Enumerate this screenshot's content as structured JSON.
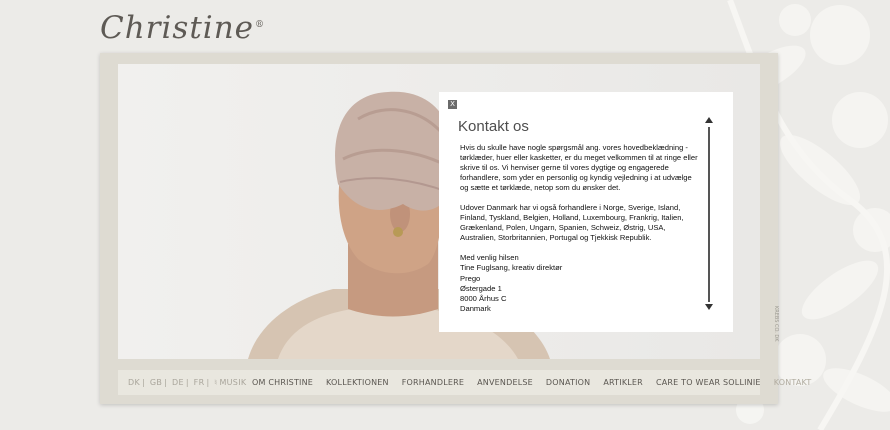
{
  "logo": {
    "text": "Christine",
    "mark": "®"
  },
  "panel": {
    "close_label": "X",
    "title": "Kontakt os",
    "paragraphs": [
      "Hvis du skulle have nogle spørgsmål ang. vores hovedbeklædning - tørklæder, huer eller kasketter, er du meget velkommen til at ringe eller skrive til os. Vi henviser gerne til vores dygtige og engagerede forhandlere, som yder en personlig og kyndig vejledning i at udvælge og sætte et tørklæde, netop som du ønsker det.",
      "Udover Danmark har vi også forhandlere i Norge, Sverige, Island, Finland, Tyskland, Belgien, Holland, Luxembourg, Frankrig, Italien, Grækenland, Polen, Ungarn, Spanien, Schweiz, Østrig, USA, Australien, Storbritannien, Portugal og Tjekkisk Republik."
    ],
    "signature": [
      "Med venlig hilsen",
      "Tine Fuglsang, kreativ direktør",
      "Prego",
      "Østergade 1",
      "8000 Århus C",
      "Danmark"
    ]
  },
  "languages": [
    "DK",
    "GB",
    "DE",
    "FR",
    "MUSIK"
  ],
  "nav": [
    "OM CHRISTINE",
    "KOLLEKTIONEN",
    "FORHANDLERE",
    "ANVENDELSE",
    "DONATION",
    "ARTIKLER",
    "CARE TO WEAR SOLLINIE",
    "KONTAKT"
  ],
  "credit": "KREBS CO. DK"
}
